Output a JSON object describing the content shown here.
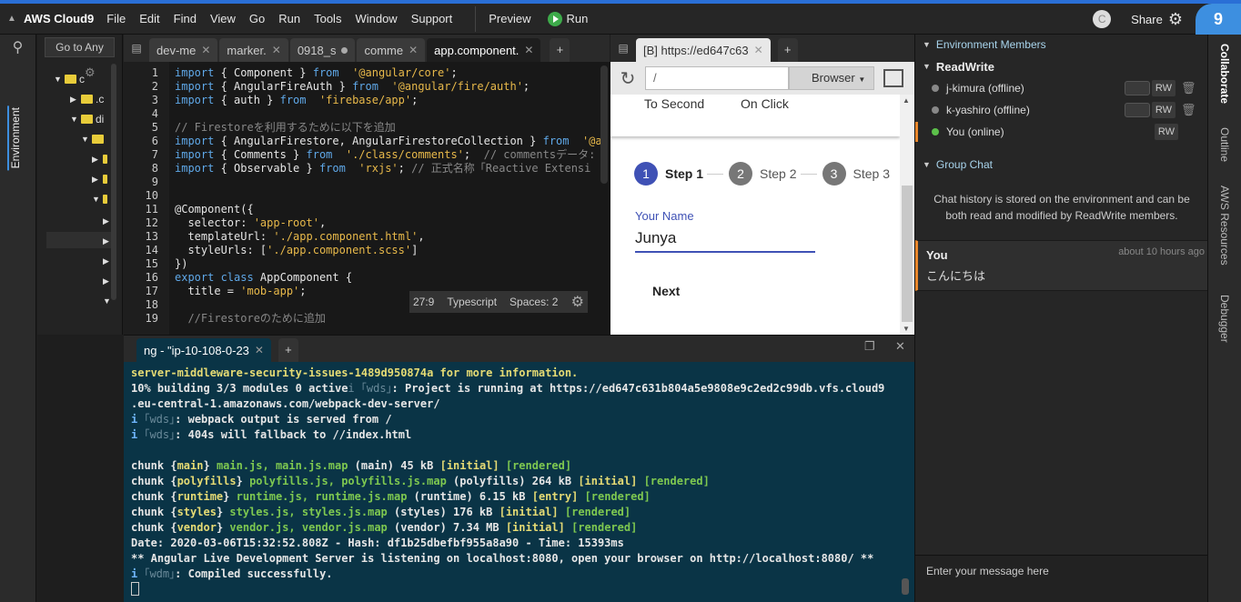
{
  "menubar": {
    "brand": "AWS Cloud9",
    "items": [
      "File",
      "Edit",
      "Find",
      "View",
      "Go",
      "Run",
      "Tools",
      "Window",
      "Support"
    ],
    "preview": "Preview",
    "run": "Run",
    "avatar": "C",
    "share": "Share",
    "logo": "9"
  },
  "sidebar": {
    "environment_label": "Environment"
  },
  "filetree": {
    "goto": "Go to Any",
    "rows": [
      {
        "label": "c"
      },
      {
        "label": ".c"
      },
      {
        "label": "di"
      },
      {
        "label": ""
      },
      {
        "label": ""
      },
      {
        "label": ""
      },
      {
        "label": ""
      }
    ]
  },
  "editor": {
    "tabs": [
      {
        "label": "dev-me",
        "state": "x"
      },
      {
        "label": "marker.",
        "state": "x"
      },
      {
        "label": "0918_s",
        "state": "dot"
      },
      {
        "label": "comme",
        "state": "x"
      },
      {
        "label": "app.component.",
        "state": "x",
        "active": true
      }
    ],
    "line_numbers": [
      "1",
      "2",
      "3",
      "4",
      "5",
      "6",
      "7",
      "8",
      "9",
      "10",
      "11",
      "12",
      "13",
      "14",
      "15",
      "16",
      "17",
      "18",
      "19"
    ],
    "lines": [
      [
        [
          "kw",
          "import"
        ],
        [
          "",
          "{ Component } "
        ],
        [
          "kw",
          "from"
        ],
        [
          "str",
          " '@angular/core'"
        ],
        [
          "",
          ";"
        ]
      ],
      [
        [
          "kw",
          "import"
        ],
        [
          "",
          "{ AngularFireAuth } "
        ],
        [
          "kw",
          "from"
        ],
        [
          "str",
          " '@angular/fire/auth'"
        ],
        [
          "",
          ";"
        ]
      ],
      [
        [
          "kw",
          "import"
        ],
        [
          "",
          "{ auth } "
        ],
        [
          "kw",
          "from"
        ],
        [
          "str",
          " 'firebase/app'"
        ],
        [
          "",
          ";"
        ]
      ],
      [],
      [
        [
          "cm",
          "// Firestoreを利用するために以下を追加"
        ]
      ],
      [
        [
          "kw",
          "import"
        ],
        [
          "",
          "{ AngularFirestore, AngularFirestoreCollection } "
        ],
        [
          "kw",
          "from"
        ],
        [
          "str",
          " '@a"
        ]
      ],
      [
        [
          "kw",
          "import"
        ],
        [
          "",
          "{ Comments } "
        ],
        [
          "kw",
          "from"
        ],
        [
          "str",
          " './class/comments'"
        ],
        [
          "",
          ";  "
        ],
        [
          "cm",
          "// commentsデータ:"
        ]
      ],
      [
        [
          "kw",
          "import"
        ],
        [
          "",
          "{ Observable } "
        ],
        [
          "kw",
          "from"
        ],
        [
          "str",
          " 'rxjs'"
        ],
        [
          "",
          "; "
        ],
        [
          "cm",
          "// 正式名称「Reactive Extensi"
        ]
      ],
      [],
      [],
      [
        [
          "",
          "@Component({"
        ]
      ],
      [
        [
          "",
          "  selector: "
        ],
        [
          "str",
          "'app-root'"
        ],
        [
          "",
          ","
        ]
      ],
      [
        [
          "",
          "  templateUrl: "
        ],
        [
          "str",
          "'./app.component.html'"
        ],
        [
          "",
          ","
        ]
      ],
      [
        [
          "",
          "  styleUrls: ["
        ],
        [
          "str",
          "'./app.component.scss'"
        ],
        [
          "",
          "]"
        ]
      ],
      [
        [
          "",
          "})"
        ]
      ],
      [
        [
          "kw",
          "export class"
        ],
        [
          "",
          "AppComponent {"
        ]
      ],
      [
        [
          "",
          "  title = "
        ],
        [
          "str",
          "'mob-app'"
        ],
        [
          "",
          ";"
        ]
      ],
      [],
      [
        [
          "cm",
          "  //Firestoreのために追加"
        ]
      ]
    ],
    "status": {
      "pos": "27:9",
      "lang": "Typescript",
      "spaces": "Spaces: 2"
    }
  },
  "browser": {
    "tab_label": "[B] https://ed647c63",
    "url": "/",
    "browser_select": "Browser",
    "top_items": [
      "To Second",
      "On Click"
    ],
    "steps": [
      {
        "num": "1",
        "label": "Step 1",
        "active": true
      },
      {
        "num": "2",
        "label": "Step 2",
        "active": false
      },
      {
        "num": "3",
        "label": "Step 3",
        "active": false
      }
    ],
    "name_label": "Your Name",
    "name_value": "Junya",
    "next_button": "Next"
  },
  "terminal": {
    "tab_label": "ng - \"ip-10-108-0-23",
    "lines": [
      [
        [
          "y",
          "server-middleware-security-issues-1489d950874a for more information."
        ]
      ],
      [
        [
          "",
          "10% building 3/3 modules 0 active"
        ],
        [
          "dim",
          "i ｢wds｣"
        ],
        [
          "",
          ": Project is running at https://ed647c631b804a5e9808e9c2ed2c99db.vfs.cloud9"
        ]
      ],
      [
        [
          "",
          ".eu-central-1.amazonaws.com/webpack-dev-server/"
        ]
      ],
      [
        [
          "bl",
          "i"
        ],
        [
          "dim",
          " ｢wds｣"
        ],
        [
          "",
          ": webpack output is served from /"
        ]
      ],
      [
        [
          "bl",
          "i"
        ],
        [
          "dim",
          " ｢wds｣"
        ],
        [
          "",
          ": 404s will fallback to //index.html"
        ]
      ],
      [],
      [
        [
          "",
          "chunk {"
        ],
        [
          "y",
          "main"
        ],
        [
          "",
          "} "
        ],
        [
          "g2",
          "main.js, main.js.map"
        ],
        [
          "",
          " (main) 45 kB "
        ],
        [
          "y",
          "[initial]"
        ],
        [
          "g2",
          " [rendered]"
        ]
      ],
      [
        [
          "",
          "chunk {"
        ],
        [
          "y",
          "polyfills"
        ],
        [
          "",
          "} "
        ],
        [
          "g2",
          "polyfills.js, polyfills.js.map"
        ],
        [
          "",
          " (polyfills) 264 kB "
        ],
        [
          "y",
          "[initial]"
        ],
        [
          "g2",
          " [rendered]"
        ]
      ],
      [
        [
          "",
          "chunk {"
        ],
        [
          "y",
          "runtime"
        ],
        [
          "",
          "} "
        ],
        [
          "g2",
          "runtime.js, runtime.js.map"
        ],
        [
          "",
          " (runtime) 6.15 kB "
        ],
        [
          "y",
          "[entry]"
        ],
        [
          "g2",
          " [rendered]"
        ]
      ],
      [
        [
          "",
          "chunk {"
        ],
        [
          "y",
          "styles"
        ],
        [
          "",
          "} "
        ],
        [
          "g2",
          "styles.js, styles.js.map"
        ],
        [
          "",
          " (styles) 176 kB "
        ],
        [
          "y",
          "[initial]"
        ],
        [
          "g2",
          " [rendered]"
        ]
      ],
      [
        [
          "",
          "chunk {"
        ],
        [
          "y",
          "vendor"
        ],
        [
          "",
          "} "
        ],
        [
          "g2",
          "vendor.js, vendor.js.map"
        ],
        [
          "",
          " (vendor) 7.34 MB "
        ],
        [
          "y",
          "[initial]"
        ],
        [
          "g2",
          " [rendered]"
        ]
      ],
      [
        [
          "",
          "Date: 2020-03-06T15:32:52.808Z - Hash: df1b25dbefbf955a8a90 - Time: 15393ms"
        ]
      ],
      [
        [
          "",
          "** Angular Live Development Server is listening on localhost:8080, open your browser on http://localhost:8080/ **"
        ]
      ],
      [
        [
          "bl",
          "i"
        ],
        [
          "dim",
          " ｢wdm｣"
        ],
        [
          "",
          ": Compiled successfully."
        ]
      ]
    ]
  },
  "collab": {
    "members_header": "Environment Members",
    "readwrite_header": "ReadWrite",
    "members": [
      {
        "name": "j-kimura (offline)",
        "online": false,
        "rw": "RW",
        "toggle": true,
        "trash": true
      },
      {
        "name": "k-yashiro (offline)",
        "online": false,
        "rw": "RW",
        "toggle": true,
        "trash": true
      },
      {
        "name": "You (online)",
        "online": true,
        "rw": "RW",
        "toggle": false,
        "trash": false
      }
    ],
    "chat_header": "Group Chat",
    "chat_info": "Chat history is stored on the environment and can be both read and modified by ReadWrite members.",
    "message": {
      "who": "You",
      "when": "about 10 hours ago",
      "text": "こんにちは"
    },
    "input_placeholder": "Enter your message here"
  },
  "right_tabs": [
    "Collaborate",
    "Outline",
    "AWS Resources",
    "Debugger"
  ]
}
